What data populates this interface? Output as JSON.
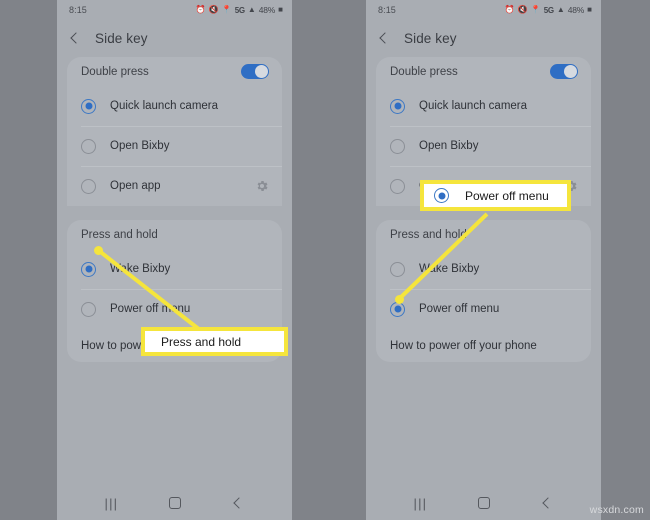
{
  "watermark": "wsxdn.com",
  "status_bar": {
    "time": "8:15",
    "icons": [
      "alarm-icon",
      "mute-icon",
      "location-icon"
    ],
    "network": "5G",
    "signal": "signal-icon",
    "battery": "48%",
    "battery_icon": "battery-icon"
  },
  "app_bar": {
    "back": "back-chevron-icon",
    "title": "Side key"
  },
  "nav_bar": {
    "recents": "|||",
    "home": "home-icon",
    "back": "back-icon"
  },
  "panels": [
    {
      "id": "left",
      "double_press": {
        "header": "Double press",
        "toggle_on": true,
        "options": [
          {
            "label": "Quick launch camera",
            "selected": true,
            "gear": false
          },
          {
            "label": "Open Bixby",
            "selected": false,
            "gear": false
          },
          {
            "label": "Open app",
            "selected": false,
            "gear": true
          }
        ]
      },
      "press_hold": {
        "header": "Press and hold",
        "options": [
          {
            "label": "Wake Bixby",
            "selected": true
          },
          {
            "label": "Power off menu",
            "selected": false
          }
        ]
      },
      "footer": "How to power off your phone"
    },
    {
      "id": "right",
      "double_press": {
        "header": "Double press",
        "toggle_on": true,
        "options": [
          {
            "label": "Quick launch camera",
            "selected": true,
            "gear": false
          },
          {
            "label": "Open Bixby",
            "selected": false,
            "gear": false
          },
          {
            "label": "Open app",
            "selected": false,
            "gear": true
          }
        ]
      },
      "press_hold": {
        "header": "Press and hold",
        "options": [
          {
            "label": "Wake Bixby",
            "selected": false
          },
          {
            "label": "Power off menu",
            "selected": true
          }
        ]
      },
      "footer": "How to power off your phone"
    }
  ],
  "annotations": {
    "callout_press_hold": "Press and hold",
    "callout_power_off": "Power off menu",
    "highlight_color": "#f5e53c"
  }
}
